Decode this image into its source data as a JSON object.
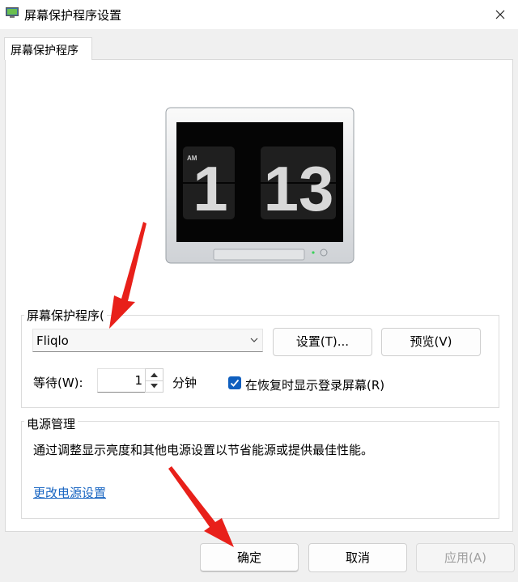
{
  "window": {
    "title": "屏幕保护程序设置"
  },
  "tabs": [
    {
      "label": "屏幕保护程序"
    }
  ],
  "preview": {
    "period": "AM",
    "hour": "1",
    "minute": "13"
  },
  "screensaver_group": {
    "title": "屏幕保护程序(",
    "selected": "Fliqlo",
    "settings_button": "设置(T)...",
    "preview_button": "预览(V)",
    "wait_label": "等待(W):",
    "wait_value": "1",
    "wait_unit": "分钟",
    "resume_checkbox_label": "在恢复时显示登录屏幕(R)",
    "resume_checked": true
  },
  "power_group": {
    "title": "电源管理",
    "description": "通过调整显示亮度和其他电源设置以节省能源或提供最佳性能。",
    "link": "更改电源设置"
  },
  "footer": {
    "ok": "确定",
    "cancel": "取消",
    "apply": "应用(A)"
  },
  "colors": {
    "accent": "#0f5fbf",
    "link": "#1a66c2",
    "annotation_arrow": "#e8201a"
  }
}
